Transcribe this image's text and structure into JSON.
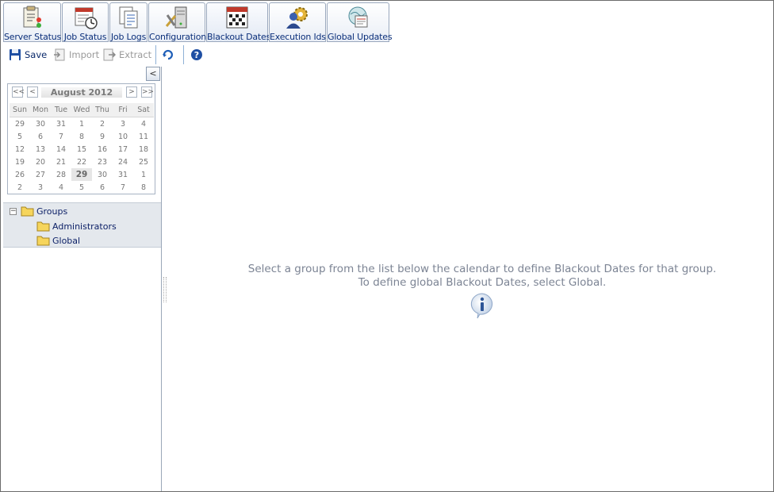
{
  "tabs": [
    {
      "label": "Server Status",
      "icon": "server-status-icon"
    },
    {
      "label": "Job Status",
      "icon": "job-status-icon"
    },
    {
      "label": "Job Logs",
      "icon": "job-logs-icon"
    },
    {
      "label": "Configuration",
      "icon": "configuration-icon"
    },
    {
      "label": "Blackout Dates",
      "icon": "calendar-grid-icon",
      "active": true
    },
    {
      "label": "Execution Ids",
      "icon": "user-gear-icon"
    },
    {
      "label": "Global Updates",
      "icon": "globe-document-icon"
    }
  ],
  "toolbar": {
    "save_label": "Save",
    "import_label": "Import",
    "extract_label": "Extract"
  },
  "calendar": {
    "collapse_label": "<",
    "nav_first": "<<",
    "nav_prev": "<",
    "nav_next": ">",
    "nav_last": ">>",
    "title": "August 2012",
    "weekdays": [
      "Sun",
      "Mon",
      "Tue",
      "Wed",
      "Thu",
      "Fri",
      "Sat"
    ],
    "weeks": [
      [
        "29",
        "30",
        "31",
        "1",
        "2",
        "3",
        "4"
      ],
      [
        "5",
        "6",
        "7",
        "8",
        "9",
        "10",
        "11"
      ],
      [
        "12",
        "13",
        "14",
        "15",
        "16",
        "17",
        "18"
      ],
      [
        "19",
        "20",
        "21",
        "22",
        "23",
        "24",
        "25"
      ],
      [
        "26",
        "27",
        "28",
        "29",
        "30",
        "31",
        "1"
      ],
      [
        "2",
        "3",
        "4",
        "5",
        "6",
        "7",
        "8"
      ]
    ],
    "today": "29"
  },
  "tree": {
    "expander": "−",
    "root": "Groups",
    "children": [
      "Administrators",
      "Global"
    ]
  },
  "message": {
    "line1": "Select a group from the list below the calendar to define Blackout Dates for that group.",
    "line2": "To define global Blackout Dates, select Global."
  },
  "colors": {
    "tab_text": "#0b2f7a",
    "tree_bg": "#e4e8ed",
    "message_text": "#7c8494",
    "folder": "#f6d55c"
  }
}
